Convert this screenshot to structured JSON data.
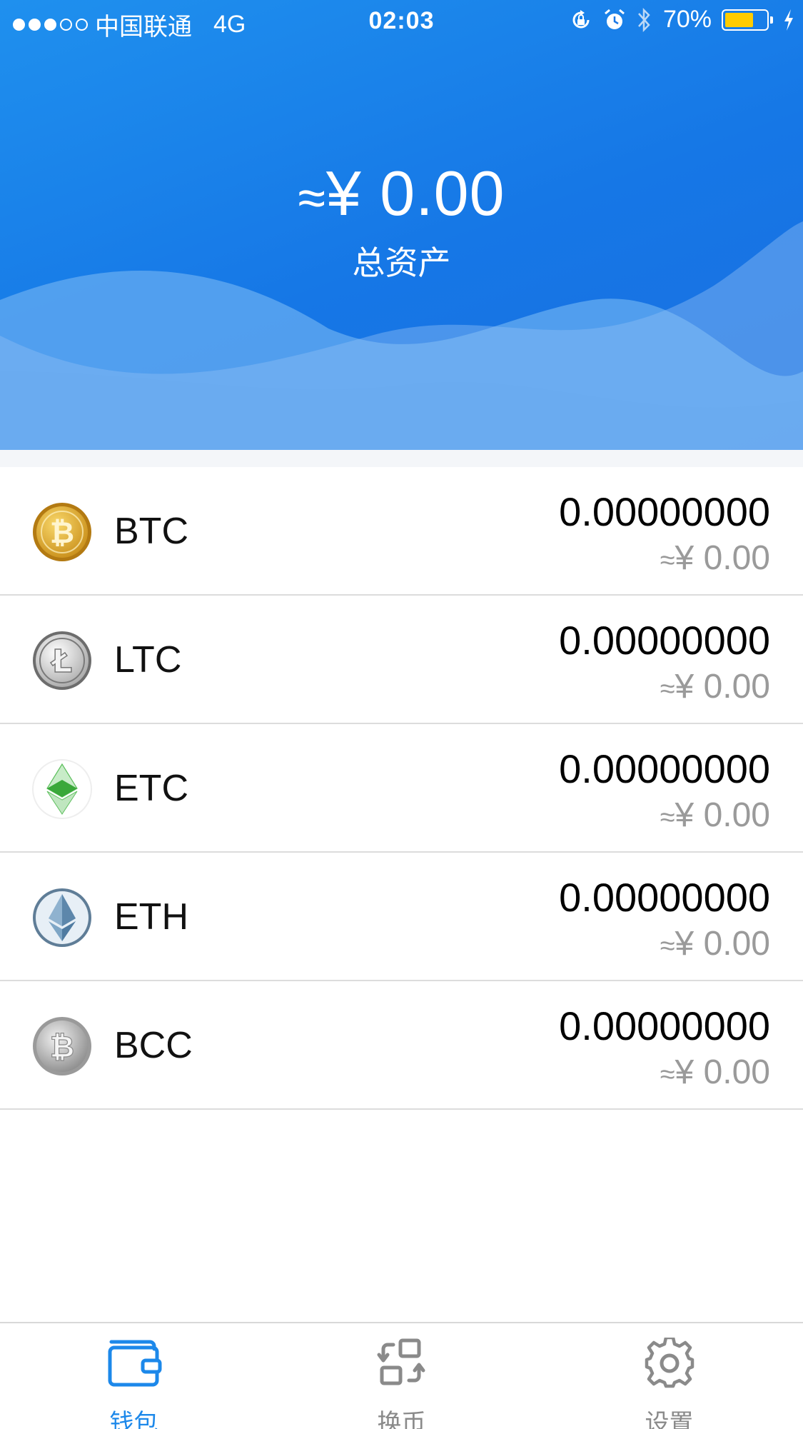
{
  "status_bar": {
    "carrier": "中国联通",
    "network": "4G",
    "time": "02:03",
    "battery": "70%",
    "battery_level": 0.7
  },
  "header": {
    "approx_symbol": "≈",
    "total_value": "¥ 0.00",
    "total_label": "总资产"
  },
  "coins": [
    {
      "symbol": "BTC",
      "amount": "0.00000000",
      "approx": "≈",
      "fiat": "¥ 0.00",
      "icon": "btc-icon"
    },
    {
      "symbol": "LTC",
      "amount": "0.00000000",
      "approx": "≈",
      "fiat": "¥ 0.00",
      "icon": "ltc-icon"
    },
    {
      "symbol": "ETC",
      "amount": "0.00000000",
      "approx": "≈",
      "fiat": "¥ 0.00",
      "icon": "etc-icon"
    },
    {
      "symbol": "ETH",
      "amount": "0.00000000",
      "approx": "≈",
      "fiat": "¥ 0.00",
      "icon": "eth-icon"
    },
    {
      "symbol": "BCC",
      "amount": "0.00000000",
      "approx": "≈",
      "fiat": "¥ 0.00",
      "icon": "bcc-icon"
    }
  ],
  "tabbar": {
    "wallet": "钱包",
    "exchange": "换币",
    "settings": "设置"
  },
  "colors": {
    "accent": "#1c88ea",
    "header_blue": "#1677e6",
    "btc_gold": "#e2a92c",
    "etc_green": "#3ab83a",
    "inactive_gray": "#8a8a8a"
  }
}
